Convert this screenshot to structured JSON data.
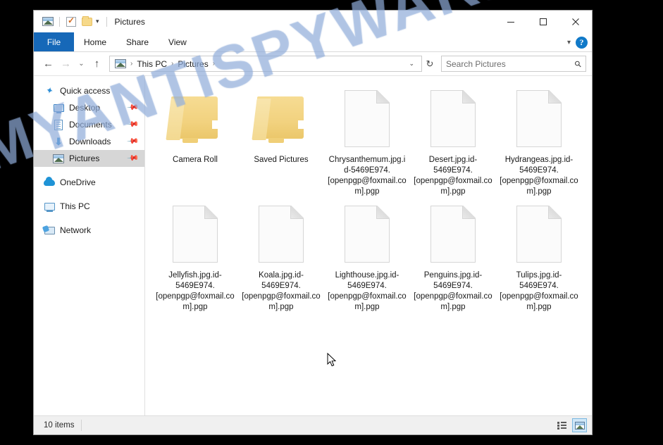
{
  "watermark": {
    "text": "MYANTISPYWARE.COM"
  },
  "window": {
    "title": "Pictures",
    "quick_access_toolbar": [
      {
        "name": "pictures-icon",
        "label": "Pictures"
      },
      {
        "name": "properties-icon",
        "label": "Properties"
      },
      {
        "name": "new-folder-icon",
        "label": "New folder"
      }
    ],
    "controls": {
      "minimize": "—",
      "maximize": "□",
      "close": "✕"
    }
  },
  "ribbon": {
    "file_tab": "File",
    "tabs": [
      "Home",
      "Share",
      "View"
    ],
    "expand_caret": "⌄",
    "help_label": "?"
  },
  "address": {
    "back": "←",
    "forward": "→",
    "recent": "⌄",
    "up": "↑",
    "crumbs": [
      "This PC",
      "Pictures"
    ],
    "separator": "›",
    "dropdown_caret": "⌄",
    "refresh": "↻"
  },
  "search": {
    "placeholder": "Search Pictures",
    "icon": "search-icon"
  },
  "sidebar": {
    "items": [
      {
        "label": "Quick access",
        "icon": "star-pin-icon",
        "indent": false,
        "selected": false,
        "pinned": false,
        "gap": false
      },
      {
        "label": "Desktop",
        "icon": "desktop-monitor-icon",
        "indent": true,
        "selected": false,
        "pinned": true,
        "gap": false
      },
      {
        "label": "Documents",
        "icon": "documents-icon",
        "indent": true,
        "selected": false,
        "pinned": true,
        "gap": false
      },
      {
        "label": "Downloads",
        "icon": "downloads-arrow-icon",
        "indent": true,
        "selected": false,
        "pinned": true,
        "gap": false
      },
      {
        "label": "Pictures",
        "icon": "pictures-icon",
        "indent": true,
        "selected": true,
        "pinned": true,
        "gap": false
      },
      {
        "label": "OneDrive",
        "icon": "onedrive-cloud-icon",
        "indent": false,
        "selected": false,
        "pinned": false,
        "gap": true
      },
      {
        "label": "This PC",
        "icon": "this-pc-icon",
        "indent": false,
        "selected": false,
        "pinned": false,
        "gap": true
      },
      {
        "label": "Network",
        "icon": "network-icon",
        "indent": false,
        "selected": false,
        "pinned": false,
        "gap": true
      }
    ]
  },
  "files": [
    {
      "name": "Camera Roll",
      "type": "folder"
    },
    {
      "name": "Saved Pictures",
      "type": "folder"
    },
    {
      "name": "Chrysanthemum.jpg.id-5469E974.[openpgp@foxmail.com].pgp",
      "type": "file"
    },
    {
      "name": "Desert.jpg.id-5469E974.[openpgp@foxmail.com].pgp",
      "type": "file"
    },
    {
      "name": "Hydrangeas.jpg.id-5469E974.[openpgp@foxmail.com].pgp",
      "type": "file"
    },
    {
      "name": "Jellyfish.jpg.id-5469E974.[openpgp@foxmail.com].pgp",
      "type": "file"
    },
    {
      "name": "Koala.jpg.id-5469E974.[openpgp@foxmail.com].pgp",
      "type": "file"
    },
    {
      "name": "Lighthouse.jpg.id-5469E974.[openpgp@foxmail.com].pgp",
      "type": "file"
    },
    {
      "name": "Penguins.jpg.id-5469E974.[openpgp@foxmail.com].pgp",
      "type": "file"
    },
    {
      "name": "Tulips.jpg.id-5469E974.[openpgp@foxmail.com].pgp",
      "type": "file"
    }
  ],
  "status": {
    "item_count": "10 items",
    "views": [
      {
        "name": "details-view-button",
        "active": false
      },
      {
        "name": "large-icons-view-button",
        "active": true
      }
    ]
  },
  "colors": {
    "file_tab_blue": "#1668b8",
    "help_blue": "#1079c8",
    "selected_nav": "#d6d6d6",
    "folder_yellow": "#f2d27f",
    "watermark": "#96b2de",
    "desktop_background": "#000000"
  }
}
